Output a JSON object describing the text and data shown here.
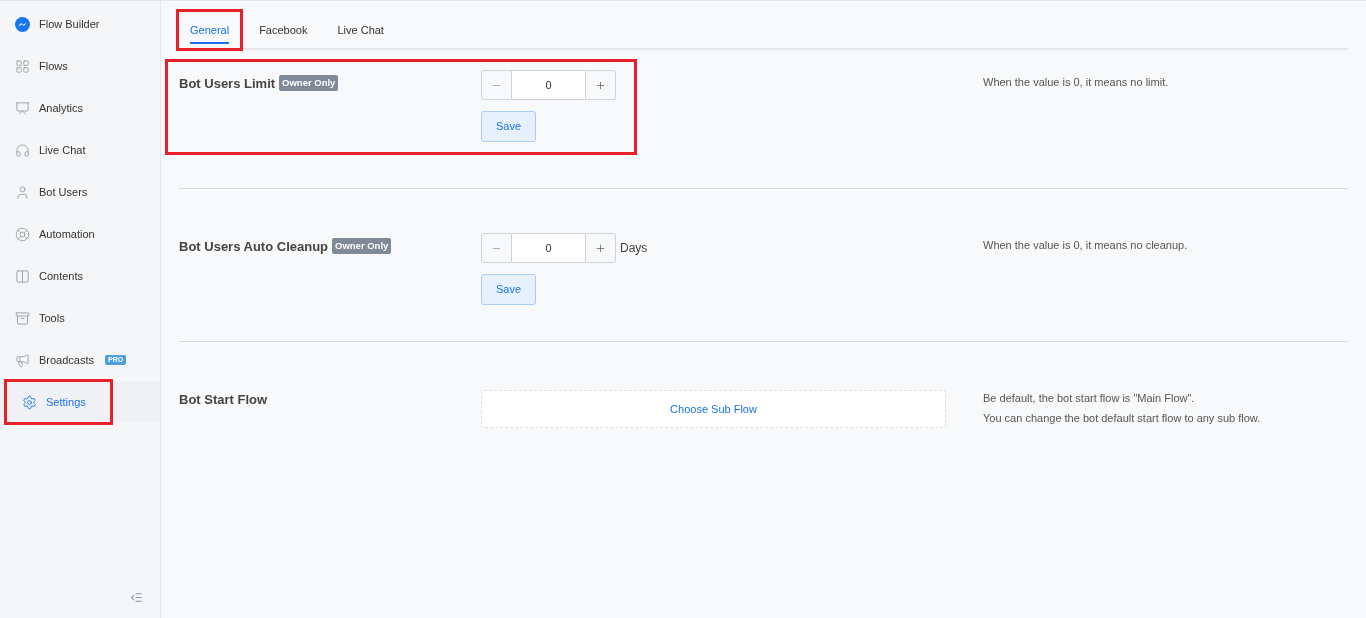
{
  "sidebar": {
    "items": [
      {
        "label": "Flow Builder",
        "selected": false,
        "highlighted": false
      },
      {
        "label": "Flows",
        "selected": false,
        "highlighted": false
      },
      {
        "label": "Analytics",
        "selected": false,
        "highlighted": false
      },
      {
        "label": "Live Chat",
        "selected": false,
        "highlighted": false
      },
      {
        "label": "Bot Users",
        "selected": false,
        "highlighted": false
      },
      {
        "label": "Automation",
        "selected": false,
        "highlighted": false
      },
      {
        "label": "Contents",
        "selected": false,
        "highlighted": false
      },
      {
        "label": "Tools",
        "selected": false,
        "highlighted": false
      },
      {
        "label": "Broadcasts",
        "badge": "PRO",
        "selected": false,
        "highlighted": false
      },
      {
        "label": "Settings",
        "selected": true,
        "highlighted": true
      }
    ]
  },
  "tabs": [
    {
      "label": "General",
      "selected": true,
      "highlighted": true
    },
    {
      "label": "Facebook",
      "selected": false,
      "highlighted": false
    },
    {
      "label": "Live Chat",
      "selected": false,
      "highlighted": false
    }
  ],
  "sections": [
    {
      "kind": "stepper",
      "title": "Bot Users Limit",
      "badge": "Owner Only",
      "value": "0",
      "save": "Save",
      "notes": [
        "When the value is 0, it means no limit."
      ],
      "highlighted": true
    },
    {
      "kind": "stepper",
      "title": "Bot Users Auto Cleanup",
      "badge": "Owner Only",
      "value": "0",
      "unit": "Days",
      "save": "Save",
      "notes": [
        "When the value is 0, it means no cleanup."
      ],
      "highlighted": false
    },
    {
      "kind": "flow_picker",
      "title": "Bot Start Flow",
      "button": "Choose Sub Flow",
      "notes": [
        "Be default, the bot start flow is \"Main Flow\".",
        "You can change the bot default start flow to any sub flow."
      ],
      "highlighted": false
    }
  ]
}
